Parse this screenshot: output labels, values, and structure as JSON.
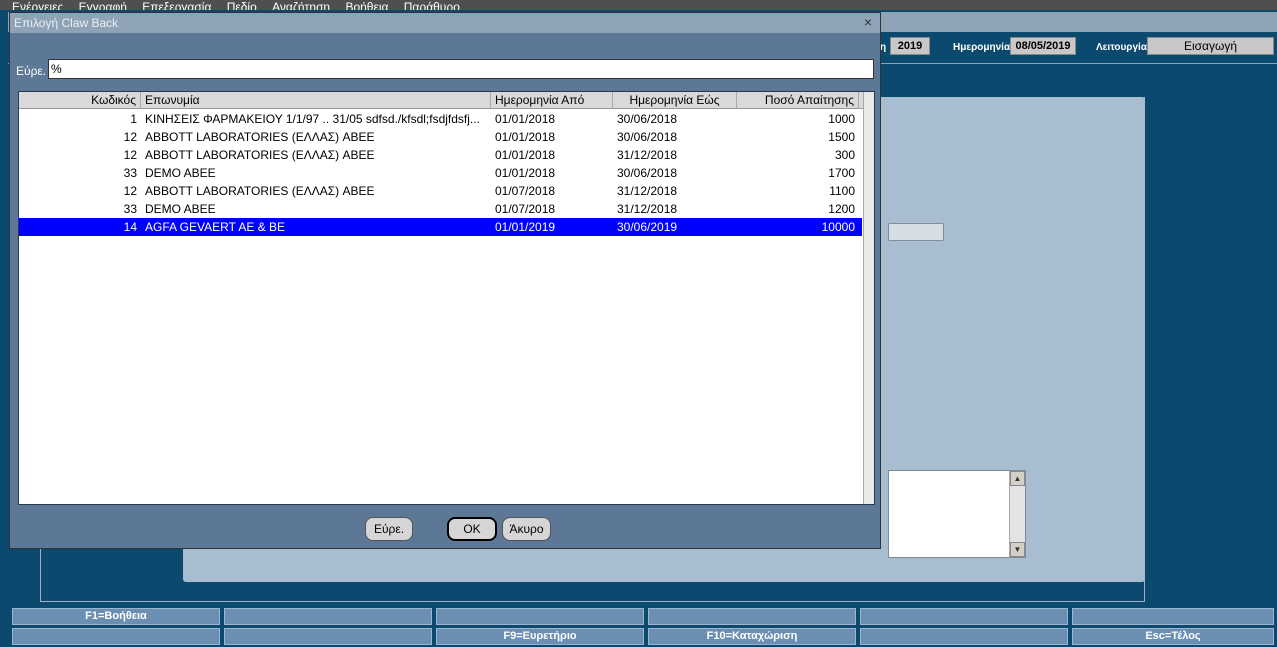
{
  "menubar": {
    "items": [
      "Ενέργειες",
      "Εγγραφή",
      "Επεξεργασία",
      "Πεδίο",
      "Αναζήτηση",
      "Βοήθεια",
      "Παράθυρο"
    ]
  },
  "app": {
    "header": {
      "year_label": "η",
      "year_value": "2019",
      "date_label": "Ημερομηνία",
      "date_value": "08/05/2019",
      "mode_label": "Λειτουργία",
      "mode_value": "Εισαγωγή"
    }
  },
  "dialog": {
    "title": "Επιλογή Claw Back",
    "close_icon": "×",
    "search_label": "Εύρε.",
    "search_value": "%",
    "columns": [
      "Κωδικός",
      "Επωνυμία",
      "Ημερομηνία Από",
      "Ημερομηνία Εώς",
      "Ποσό Απαίτησης"
    ],
    "rows": [
      {
        "code": "1",
        "name": "ΚΙΝΗΣΕΙΣ ΦΑΡΜΑΚΕΙΟΥ 1/1/97 .. 31/05 sdfsd./kfsdl;fsdjfdsfj...",
        "from": "01/01/2018",
        "to": "30/06/2018",
        "amount": "1000"
      },
      {
        "code": "12",
        "name": "ABBOTT LABORATORIES (ΕΛΛΑΣ) ΑΒΕΕ",
        "from": "01/01/2018",
        "to": "30/06/2018",
        "amount": "1500"
      },
      {
        "code": "12",
        "name": "ABBOTT LABORATORIES (ΕΛΛΑΣ) ΑΒΕΕ",
        "from": "01/01/2018",
        "to": "31/12/2018",
        "amount": "300"
      },
      {
        "code": "33",
        "name": "DEMO ABEE",
        "from": "01/01/2018",
        "to": "30/06/2018",
        "amount": "1700"
      },
      {
        "code": "12",
        "name": "ABBOTT LABORATORIES (ΕΛΛΑΣ) ΑΒΕΕ",
        "from": "01/07/2018",
        "to": "31/12/2018",
        "amount": "1100"
      },
      {
        "code": "33",
        "name": "DEMO ABEE",
        "from": "01/07/2018",
        "to": "31/12/2018",
        "amount": "1200"
      },
      {
        "code": "14",
        "name": "AGFA GEVAERT AE & BE",
        "from": "01/01/2019",
        "to": "30/06/2019",
        "amount": "10000",
        "selected": true
      }
    ],
    "buttons": {
      "find": "Εύρε.",
      "ok": "OK",
      "cancel": "Άκυρο"
    }
  },
  "fkeys": {
    "row1": [
      "F1=Βοήθεια",
      "",
      "",
      "",
      "",
      ""
    ],
    "row2": [
      "",
      "",
      "F9=Ευρετήριο",
      "F10=Καταχώριση",
      "",
      "Esc=Τέλος"
    ]
  }
}
